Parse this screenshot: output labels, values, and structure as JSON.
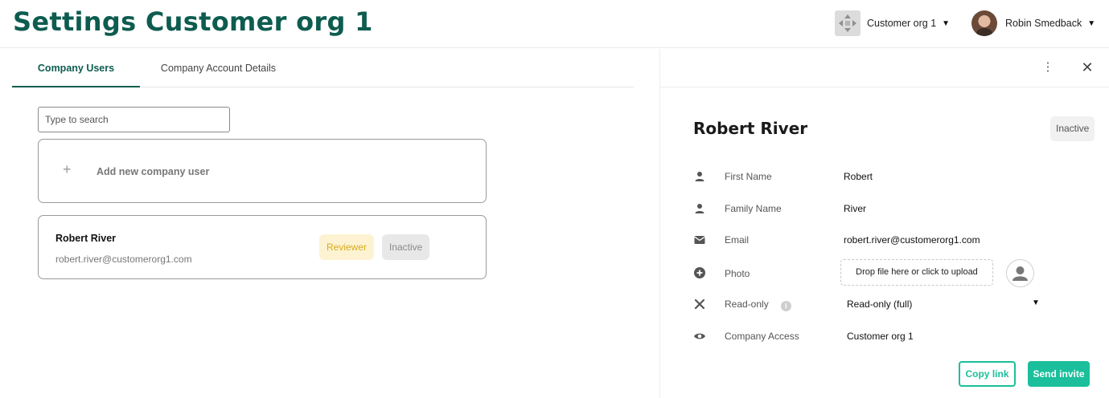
{
  "header": {
    "title": "Settings Customer org 1",
    "org_name": "Customer org 1",
    "user_name": "Robin Smedback",
    "caret": "▼"
  },
  "tabs": [
    {
      "label": "Company Users",
      "active": true
    },
    {
      "label": "Company Account Details",
      "active": false
    }
  ],
  "search": {
    "placeholder": "Type to search",
    "value": ""
  },
  "add_user": {
    "icon": "+",
    "label": "Add new company user"
  },
  "user_list": [
    {
      "name": "Robert River",
      "email": "robert.river@customerorg1.com",
      "role_badge": "Reviewer",
      "status_badge": "Inactive"
    }
  ],
  "detail": {
    "more_icon": "⋮",
    "close_icon": "✕",
    "name": "Robert River",
    "status": "Inactive",
    "fields": {
      "first_name": {
        "label": "First Name",
        "value": "Robert",
        "icon": "person-icon"
      },
      "family_name": {
        "label": "Family Name",
        "value": "River",
        "icon": "person-icon"
      },
      "email": {
        "label": "Email",
        "value": "robert.river@customerorg1.com",
        "icon": "mail-icon"
      },
      "photo": {
        "label": "Photo",
        "dropzone": "Drop file here or click to upload",
        "icon": "add-circle-icon"
      },
      "read_only": {
        "label": "Read-only",
        "info": "i",
        "value": "Read-only (full)",
        "icon": "tools-icon"
      },
      "company_access": {
        "label": "Company Access",
        "value": "Customer org 1",
        "icon": "eye-icon"
      }
    },
    "buttons": {
      "copy_link": "Copy link",
      "send_invite": "Send invite"
    }
  },
  "colors": {
    "brand_dark": "#0d5c4f",
    "accent": "#1bbf9b",
    "reviewer_bg": "#fdf3d2",
    "reviewer_text": "#d9aa1f"
  }
}
